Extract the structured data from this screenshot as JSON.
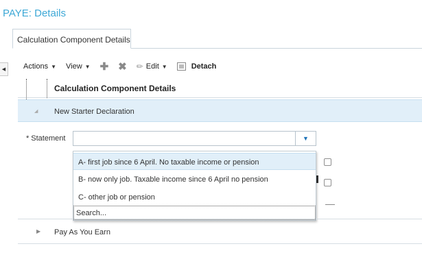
{
  "page": {
    "title": "PAYE: Details"
  },
  "tabs": [
    {
      "label": "Calculation Component Details"
    }
  ],
  "toolbar": {
    "actions_label": "Actions",
    "view_label": "View",
    "edit_label": "Edit",
    "detach_label": "Detach"
  },
  "table": {
    "header": "Calculation Component Details",
    "rows": [
      {
        "label": "New Starter Declaration",
        "state": "expanded"
      },
      {
        "label": "Pay As You Earn",
        "state": "collapsed"
      }
    ]
  },
  "form": {
    "statement_label": "Statement",
    "required_marker": "*",
    "statement_value": ""
  },
  "dropdown": {
    "options": [
      "A- first job since 6 April. No taxable income or pension",
      "B- now only job. Taxable income since 6 April no pension",
      "C- other job or pension"
    ],
    "search_label": "Search..."
  },
  "icons": {
    "collapse": "collapse-panel-icon",
    "add": "plus-icon",
    "delete": "x-icon",
    "edit": "pencil-icon",
    "detach": "detach-icon",
    "dropdown": "chevron-down-icon"
  },
  "colors": {
    "title": "#3da8d6",
    "selected_row": "#e1eff9",
    "accent": "#1e73b8"
  }
}
